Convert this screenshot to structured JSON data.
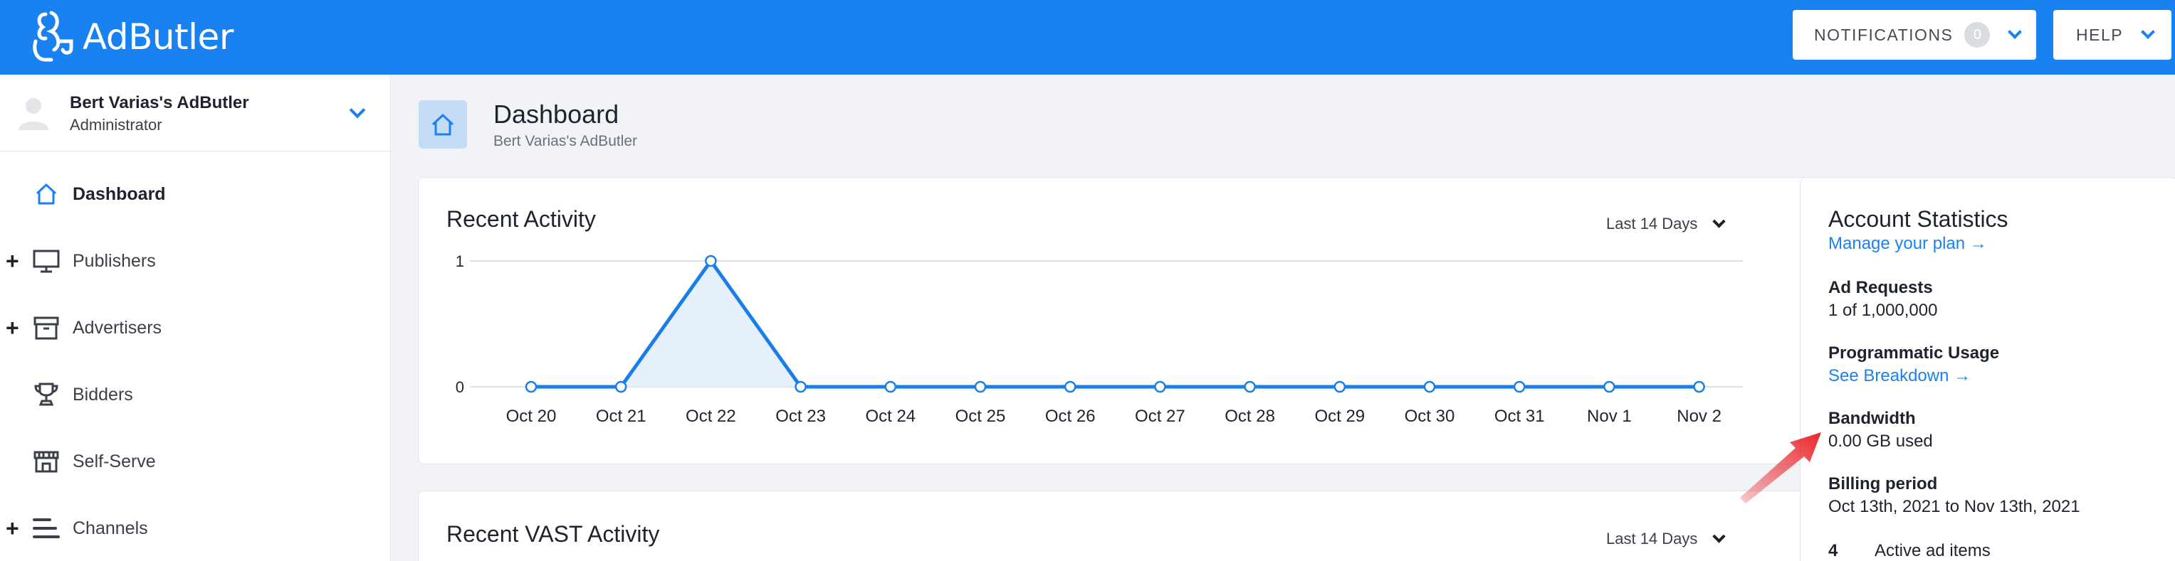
{
  "brand": {
    "name": "AdButler"
  },
  "topbar": {
    "notifications_label": "NOTIFICATIONS",
    "notifications_count": "0",
    "help_label": "HELP"
  },
  "account": {
    "name": "Bert Varias's AdButler",
    "role": "Administrator"
  },
  "sidebar": {
    "items": [
      {
        "label": "Dashboard",
        "icon": "home-icon",
        "active": true,
        "expandable": false
      },
      {
        "label": "Publishers",
        "icon": "monitor-icon",
        "active": false,
        "expandable": true
      },
      {
        "label": "Advertisers",
        "icon": "archive-icon",
        "active": false,
        "expandable": true
      },
      {
        "label": "Bidders",
        "icon": "trophy-icon",
        "active": false,
        "expandable": false
      },
      {
        "label": "Self-Serve",
        "icon": "storefront-icon",
        "active": false,
        "expandable": false
      },
      {
        "label": "Channels",
        "icon": "channels-icon",
        "active": false,
        "expandable": true
      }
    ]
  },
  "page": {
    "title": "Dashboard",
    "subtitle": "Bert Varias's AdButler"
  },
  "recent_activity": {
    "title": "Recent Activity",
    "range": "Last 14 Days"
  },
  "recent_vast": {
    "title": "Recent VAST Activity",
    "range": "Last 14 Days"
  },
  "chart_data": {
    "type": "area",
    "title": "Recent Activity",
    "categories": [
      "Oct 20",
      "Oct 21",
      "Oct 22",
      "Oct 23",
      "Oct 24",
      "Oct 25",
      "Oct 26",
      "Oct 27",
      "Oct 28",
      "Oct 29",
      "Oct 30",
      "Oct 31",
      "Nov 1",
      "Nov 2"
    ],
    "values": [
      0,
      0,
      1,
      0,
      0,
      0,
      0,
      0,
      0,
      0,
      0,
      0,
      0,
      0
    ],
    "yticks": [
      "0",
      "1"
    ],
    "ylim": [
      0,
      1
    ],
    "grid": true,
    "line_color": "#1a7ee8",
    "fill_color": "#e6f0fb"
  },
  "stats": {
    "title": "Account Statistics",
    "manage_link": "Manage your plan →",
    "ad_requests_label": "Ad Requests",
    "ad_requests_value": "1 of 1,000,000",
    "programmatic_label": "Programmatic Usage",
    "breakdown_link": "See Breakdown →",
    "bandwidth_label": "Bandwidth",
    "bandwidth_value": "0.00 GB used",
    "billing_label": "Billing period",
    "billing_value": "Oct 13th, 2021 to Nov 13th, 2021",
    "active_count": "4",
    "active_label": "Active ad items"
  },
  "colors": {
    "brand": "#1a82f0",
    "annotation_arrow": "#e8262c"
  }
}
